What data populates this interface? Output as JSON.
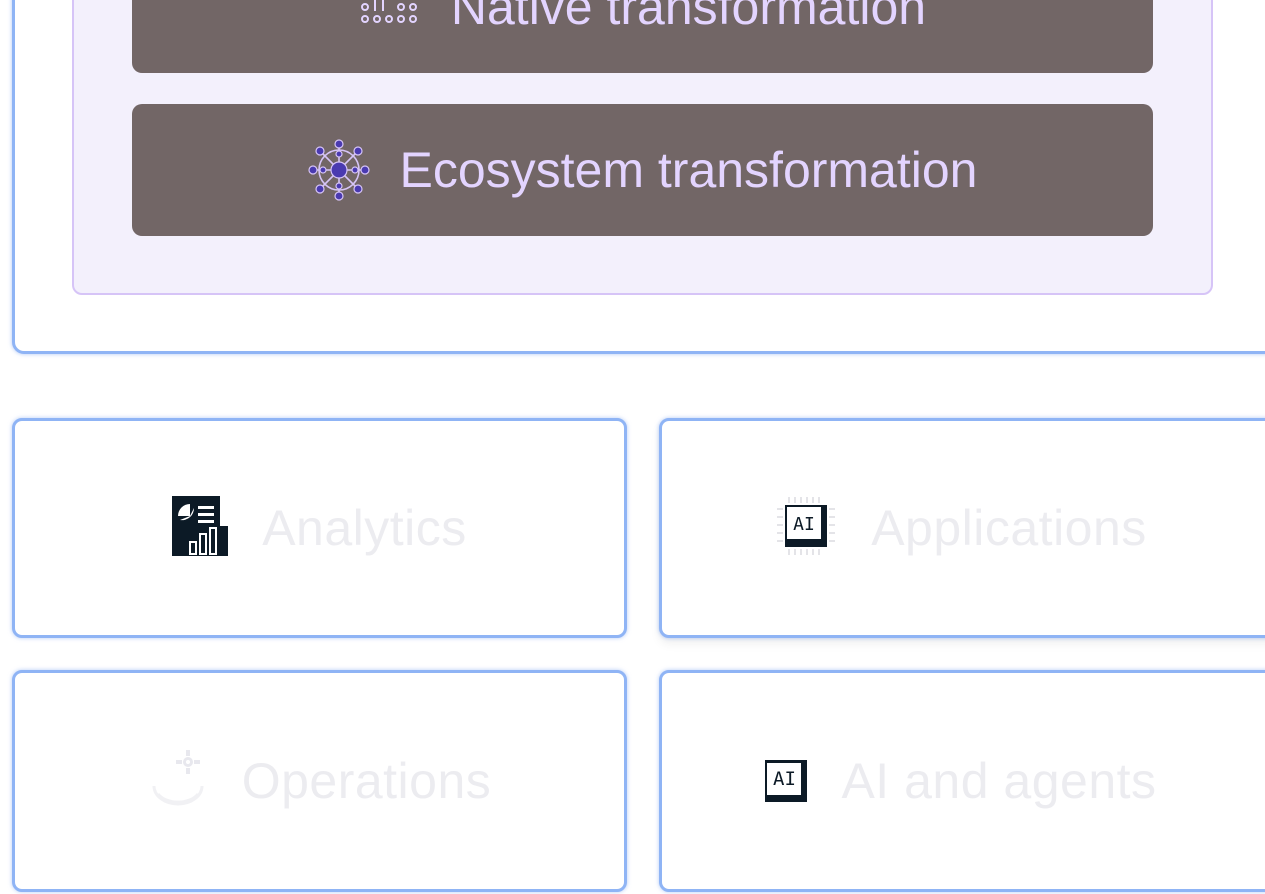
{
  "transformations": {
    "native_label": "Native transformation",
    "ecosystem_label": "Ecosystem transformation",
    "native_icon": "circuit-pins-icon",
    "ecosystem_icon": "network-nodes-icon",
    "button_color": "#726666",
    "label_color": "#e3d4ff",
    "panel_color": "#f3f0fc"
  },
  "categories": [
    {
      "label": "Analytics",
      "icon": "analytics-report-icon"
    },
    {
      "label": "Applications",
      "icon": "ai-chip-icon",
      "icon_text": "AI"
    },
    {
      "label": "Operations",
      "icon": "operations-gear-icon"
    },
    {
      "label": "AI and agents",
      "icon": "ai-chip-icon",
      "icon_text": "AI"
    }
  ],
  "colors": {
    "card_border": "#8fb4f5",
    "card_label": "#ececf0",
    "icon_dark": "#0c1a26"
  }
}
